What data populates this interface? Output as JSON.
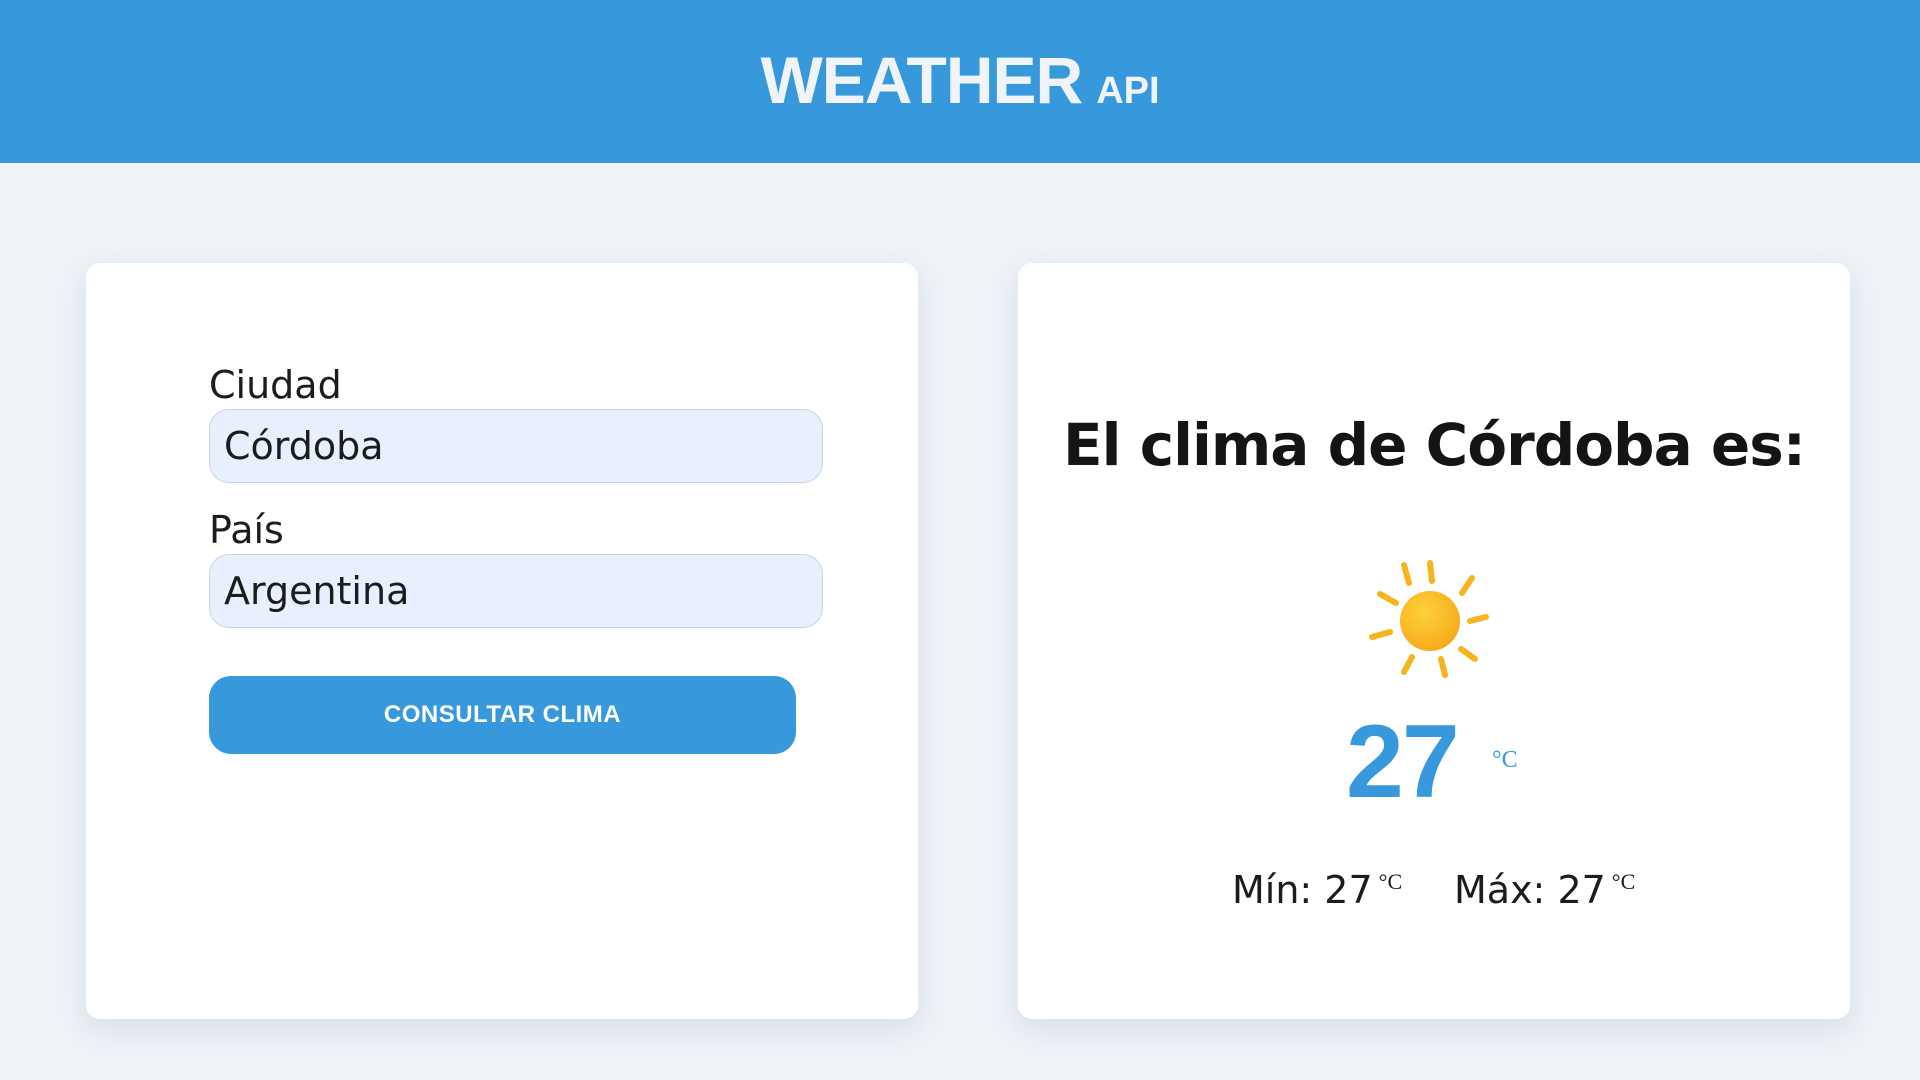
{
  "header": {
    "logo_main": "WEATHER",
    "logo_sub": "API",
    "background_color": "#3898dc"
  },
  "form": {
    "city_label": "Ciudad",
    "city_value": "Córdoba",
    "country_label": "País",
    "country_value": "Argentina",
    "submit_label": "CONSULTAR CLIMA"
  },
  "result": {
    "title": "El clima de Córdoba es:",
    "icon": "sun-icon",
    "temperature": "27",
    "temperature_unit": "°C",
    "min_label": "Mín: 27",
    "min_unit": "°C",
    "max_label": "Máx: 27",
    "max_unit": "°C",
    "accent_color": "#3898dc"
  }
}
